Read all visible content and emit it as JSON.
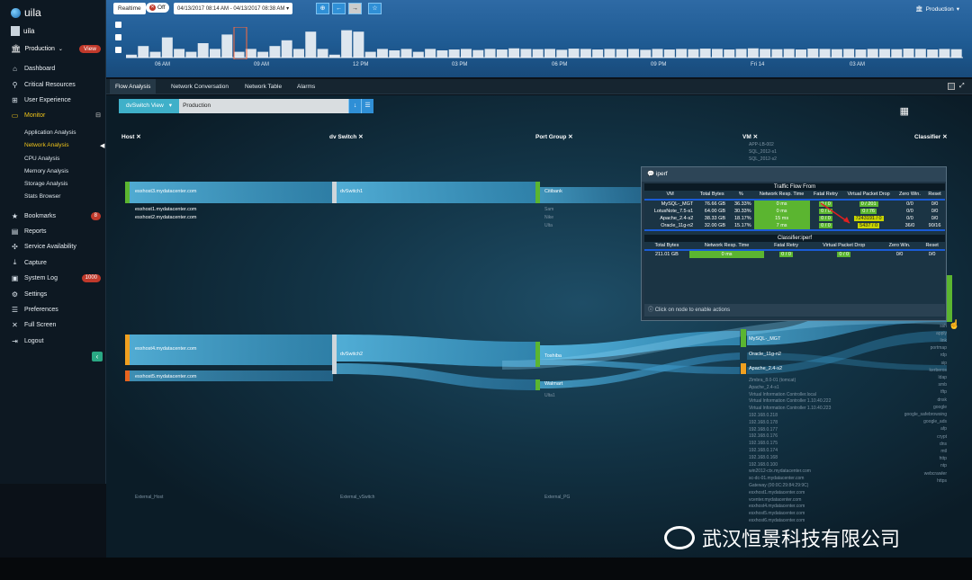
{
  "app": {
    "logo_text": "uila",
    "user": "uila",
    "env": "Production",
    "view_badge": "View"
  },
  "nav": [
    {
      "label": "Dashboard",
      "icon": "home-icon"
    },
    {
      "label": "Critical Resources",
      "icon": "pin-icon"
    },
    {
      "label": "User Experience",
      "icon": "sitemap-icon"
    },
    {
      "label": "Monitor",
      "icon": "monitor-icon"
    },
    {
      "label": "Bookmarks",
      "icon": "star-icon",
      "badge": "8"
    },
    {
      "label": "Reports",
      "icon": "report-icon"
    },
    {
      "label": "Service Availability",
      "icon": "network-icon"
    },
    {
      "label": "Capture",
      "icon": "download-icon"
    },
    {
      "label": "System Log",
      "icon": "log-icon",
      "badge": "1000"
    },
    {
      "label": "Settings",
      "icon": "gear-icon"
    },
    {
      "label": "Preferences",
      "icon": "sliders-icon"
    },
    {
      "label": "Full Screen",
      "icon": "expand-icon"
    },
    {
      "label": "Logout",
      "icon": "logout-icon"
    }
  ],
  "monitor_sub": [
    "Application Analysis",
    "Network Analysis",
    "CPU Analysis",
    "Memory Analysis",
    "Storage Analysis",
    "Stats Browser"
  ],
  "header": {
    "realtime": "Realtime",
    "off": "Off",
    "range": "04/13/2017 08:14 AM - 04/13/2017 08:38 AM",
    "env": "Production",
    "ticks": [
      "06 AM",
      "09 AM",
      "12 PM",
      "03 PM",
      "06 PM",
      "09 PM",
      "Fri 14",
      "03 AM"
    ]
  },
  "tabs": [
    "Flow Analysis",
    "Network Conversation",
    "Network Table",
    "Alarms"
  ],
  "selector": {
    "view": "dvSwitch View",
    "value": "Production"
  },
  "columns": [
    "Host",
    "dv Switch",
    "Port Group",
    "VM",
    "Classifier"
  ],
  "hosts": {
    "h3": "esxhost3.mydatacenter.com",
    "h1": "esxhost1.mydatacenter.com",
    "h2": "esxhost2.mydatacenter.com",
    "h4": "esxhost4.mydatacenter.com",
    "h5": "esxhost5.mydatacenter.com",
    "ext": "External_Host"
  },
  "switches": {
    "s1": "dvSwitch1",
    "s2": "dvSwitch2",
    "ext": "External_vSwitch"
  },
  "ports": {
    "p1": "Citibank",
    "p1a": "Sam",
    "p1b": "Nike",
    "p1c": "Ulta",
    "p2": "Toshiba",
    "p3": "Walmart",
    "p3a": "Ulta1",
    "ext": "External_PG"
  },
  "vms": {
    "top": [
      "APP-LB-002",
      "SQL_2012-s1",
      "SQL_2012-s2"
    ],
    "v1": "MySQL-_MGT",
    "v1b": "Oracle_11g-n2",
    "v2": "Apache_2.4-s2",
    "rest": [
      "Zimbra_8.0-01 (tomcat)",
      "Apache_2.4-s1",
      "Virtual Information Controller.local",
      "Virtual Information Controller 1.10.40.222",
      "Virtual Information Controller 1.10.40.223",
      "192.168.0.218",
      "192.168.0.178",
      "192.168.0.177",
      "192.168.0.176",
      "192.168.0.175",
      "192.168.0.174",
      "192.168.0.168",
      "192.168.0.100",
      "win2012-ctx.mydatacenter.com",
      "sc-dc-01.mydatacenter.com",
      "Gateway (00:0C:29:84:29:9C)",
      "esxhost1.mydatacenter.com",
      "vcenter.mydatacenter.com",
      "esxhost4.mydatacenter.com",
      "esxhost5.mydatacenter.com",
      "esxhost6.mydatacenter.com"
    ]
  },
  "classifiers": [
    "iperf",
    "snmp",
    "rtsp",
    "ssh",
    "apply",
    "link",
    "portmap",
    "rdp",
    "sip",
    "kerberos",
    "ldap",
    "smb",
    "tftp",
    "dnsk",
    "google",
    "google_safebrowsing",
    "google_ads",
    "afp",
    "crypt",
    "dns",
    "mtl",
    "http",
    "ntp",
    "webcrawler",
    "https"
  ],
  "popup": {
    "title": "iperf",
    "t1_title": "Traffic Flow From",
    "t1_headers": [
      "VM",
      "Total Bytes",
      "%",
      "Network Resp. Time",
      "Fatal Retry",
      "Virtual Packet Drop",
      "Zero Win.",
      "Reset"
    ],
    "t1_rows": [
      {
        "vm": "MySQL-_MGT",
        "bytes": "76.66 GB",
        "pct": "36.33%",
        "rt": "0 ms",
        "fr": "0 / 0",
        "vpd": "0 / 201",
        "zw": "0/0",
        "rs": "0/0"
      },
      {
        "vm": "LotusNote_7.5-s1",
        "bytes": "64.00 GB",
        "pct": "30.33%",
        "rt": "0 ms",
        "fr": "0 / 0",
        "vpd": "0 / 76",
        "zw": "0/0",
        "rs": "0/0"
      },
      {
        "vm": "Apache_2.4-s2",
        "bytes": "38.33 GB",
        "pct": "18.17%",
        "rt": "15 ms",
        "fr": "0 / 0",
        "vpd": "7243191 / 0",
        "zw": "0/0",
        "rs": "0/0"
      },
      {
        "vm": "Oracle_11g-n2",
        "bytes": "32.00 GB",
        "pct": "15.17%",
        "rt": "7 ms",
        "fr": "0 / 0",
        "vpd": "5437 / 0",
        "zw": "36/0",
        "rs": "90/16"
      }
    ],
    "t2_title": "Classifier:iperf",
    "t2_headers": [
      "Total Bytes",
      "Network Resp. Time",
      "Fatal Retry",
      "Virtual Packet Drop",
      "Zero Win.",
      "Reset"
    ],
    "t2_row": {
      "bytes": "211.01 GB",
      "rt": "0 ms",
      "fr": "0 / 0",
      "vpd": "0 / 0",
      "zw": "0/0",
      "rs": "0/0"
    },
    "footer": "Click on node to enable actions"
  },
  "watermark": "武汉恒景科技有限公司",
  "colors": {
    "accent": "#f0c419",
    "node_green": "#5bb530",
    "flow": "#4fb3e0",
    "badge_red": "#c0392b"
  },
  "timeline_levels": [
    0.1,
    0.4,
    0.2,
    0.7,
    0.3,
    0.2,
    0.5,
    0.3,
    0.8,
    0.2,
    0.3,
    0.2,
    0.4,
    0.6,
    0.3,
    0.9,
    0.3,
    0.1,
    0.95,
    0.9,
    0.2,
    0.3,
    0.25,
    0.3,
    0.2,
    0.3,
    0.25,
    0.28,
    0.3,
    0.26,
    0.3,
    0.28,
    0.32,
    0.3,
    0.29,
    0.3,
    0.27,
    0.31,
    0.3,
    0.28,
    0.3,
    0.29,
    0.3,
    0.27,
    0.3,
    0.28,
    0.3,
    0.29,
    0.31,
    0.3,
    0.28,
    0.3,
    0.32,
    0.3,
    0.29,
    0.3,
    0.28,
    0.31,
    0.3,
    0.29,
    0.3,
    0.28,
    0.3,
    0.3,
    0.29,
    0.31,
    0.3,
    0.28,
    0.3,
    0.29
  ]
}
